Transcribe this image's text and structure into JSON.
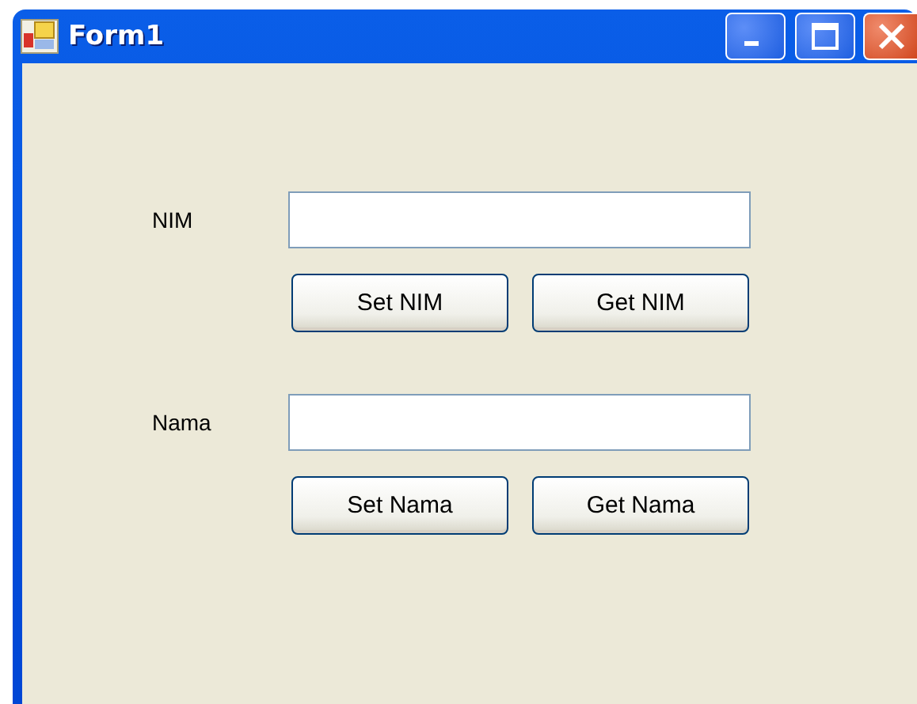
{
  "window": {
    "title": "Form1"
  },
  "groups": [
    {
      "label": "NIM",
      "buttons": [
        "Set NIM",
        "Get NIM"
      ]
    },
    {
      "label": "Nama",
      "buttons": [
        "Set Nama",
        "Get Nama"
      ]
    }
  ]
}
